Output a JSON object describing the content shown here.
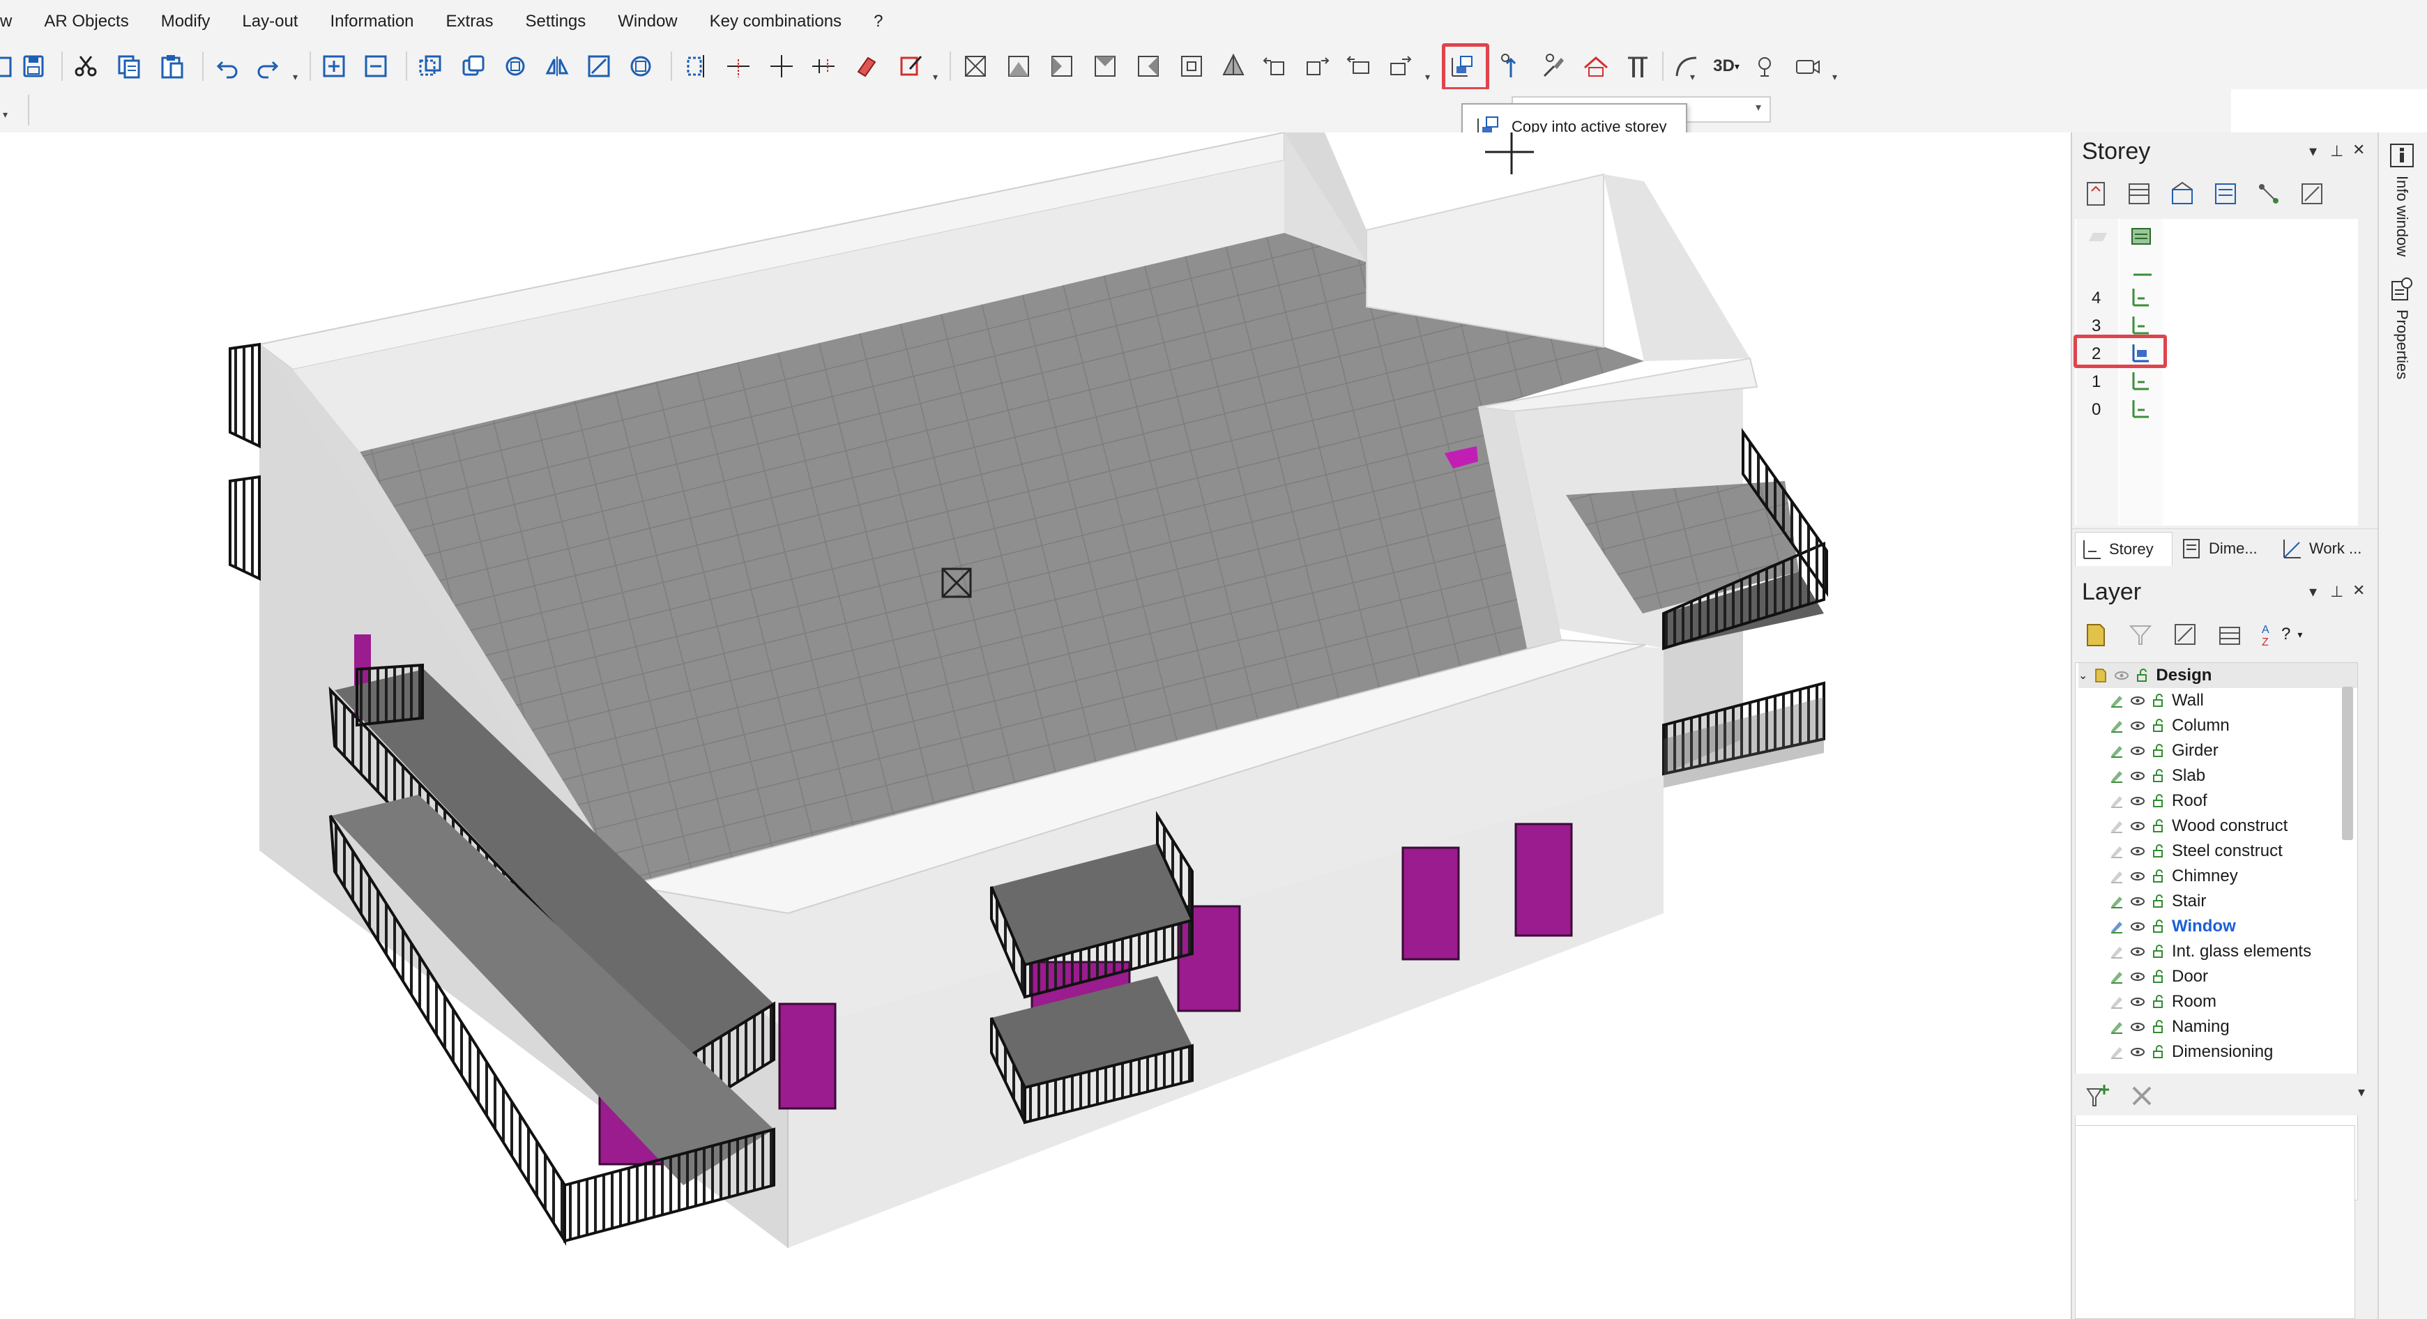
{
  "menu": {
    "items": [
      "w",
      "AR Objects",
      "Modify",
      "Lay-out",
      "Information",
      "Extras",
      "Settings",
      "Window",
      "Key combinations",
      "?"
    ]
  },
  "toolbar": {
    "icons": [
      "save-as-icon",
      "cut-icon",
      "copy-icon",
      "paste-icon",
      "undo-icon",
      "redo-icon",
      "zoom-in-icon",
      "zoom-out-icon",
      "copy-element-icon",
      "duplicate-icon",
      "rotate-icon",
      "mirror-icon",
      "scale-icon",
      "multi-copy-icon",
      "split-icon",
      "cross-line-icon",
      "point-line-icon",
      "dimension-line-icon",
      "eraser-icon",
      "edit-pen-icon",
      "box-1-icon",
      "box-2-icon",
      "box-3-icon",
      "box-4-icon",
      "box-5-icon",
      "box-6-icon",
      "prism-icon",
      "move-left-icon",
      "move-right-icon",
      "transfer-icon",
      "copy-into-storey-icon",
      "raise-icon",
      "brush-icon",
      "roof-icon",
      "column-tool-icon",
      "curve-icon",
      "view-3d-icon",
      "light-icon",
      "camera-icon"
    ],
    "view_3d_label": "3D"
  },
  "tooltip": {
    "text": "Copy into active storey"
  },
  "storey_panel": {
    "title": "Storey",
    "storeys": [
      {
        "number": "4",
        "active": false
      },
      {
        "number": "3",
        "active": false
      },
      {
        "number": "2",
        "active": true
      },
      {
        "number": "1",
        "active": false
      },
      {
        "number": "0",
        "active": false
      }
    ],
    "tabs": [
      "Storey",
      "Dime...",
      "Work ..."
    ]
  },
  "layer_panel": {
    "title": "Layer",
    "sort_label": "?",
    "group": "Design",
    "layers": [
      {
        "name": "Wall",
        "selected": false
      },
      {
        "name": "Column",
        "selected": false
      },
      {
        "name": "Girder",
        "selected": false
      },
      {
        "name": "Slab",
        "selected": false
      },
      {
        "name": "Roof",
        "selected": false
      },
      {
        "name": "Wood construct",
        "selected": false
      },
      {
        "name": "Steel construct",
        "selected": false
      },
      {
        "name": "Chimney",
        "selected": false
      },
      {
        "name": "Stair",
        "selected": false
      },
      {
        "name": "Window",
        "selected": true
      },
      {
        "name": "Int. glass elements",
        "selected": false
      },
      {
        "name": "Door",
        "selected": false
      },
      {
        "name": "Room",
        "selected": false
      },
      {
        "name": "Naming",
        "selected": false
      },
      {
        "name": "Dimensioning",
        "selected": false
      }
    ]
  },
  "side_tabs": [
    "Info window",
    "Properties"
  ],
  "colors": {
    "highlight": "#e0434b",
    "selected_text": "#1b5fd6",
    "window_magenta": "#a51a9a",
    "floor_gray": "#8e8e8e",
    "wall_white": "#e9e9e9"
  }
}
